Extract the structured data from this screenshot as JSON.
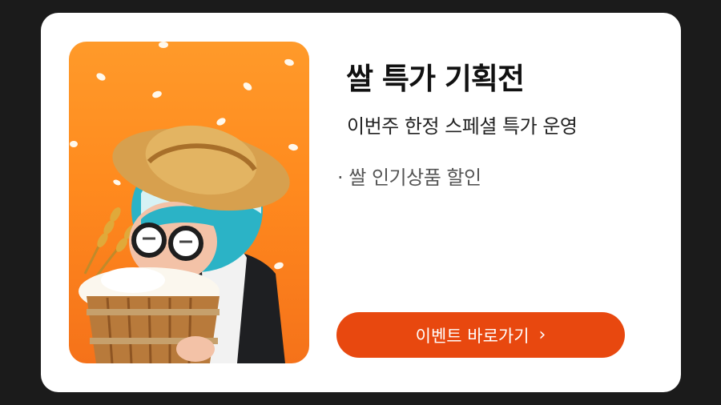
{
  "event": {
    "title": "쌀 특가 기획전",
    "subtitle": "이번주 한정 스페셜 특가 운영",
    "bullet": "· 쌀 인기상품 할인"
  },
  "cta": {
    "label": "이벤트 바로가기",
    "chevron": "›"
  },
  "colors": {
    "background": "#1b1b1b",
    "card": "#ffffff",
    "accent": "#e8480f",
    "visual_orange": "#ff8a1e"
  },
  "icons": {
    "cta_arrow": "chevron-right-icon"
  }
}
